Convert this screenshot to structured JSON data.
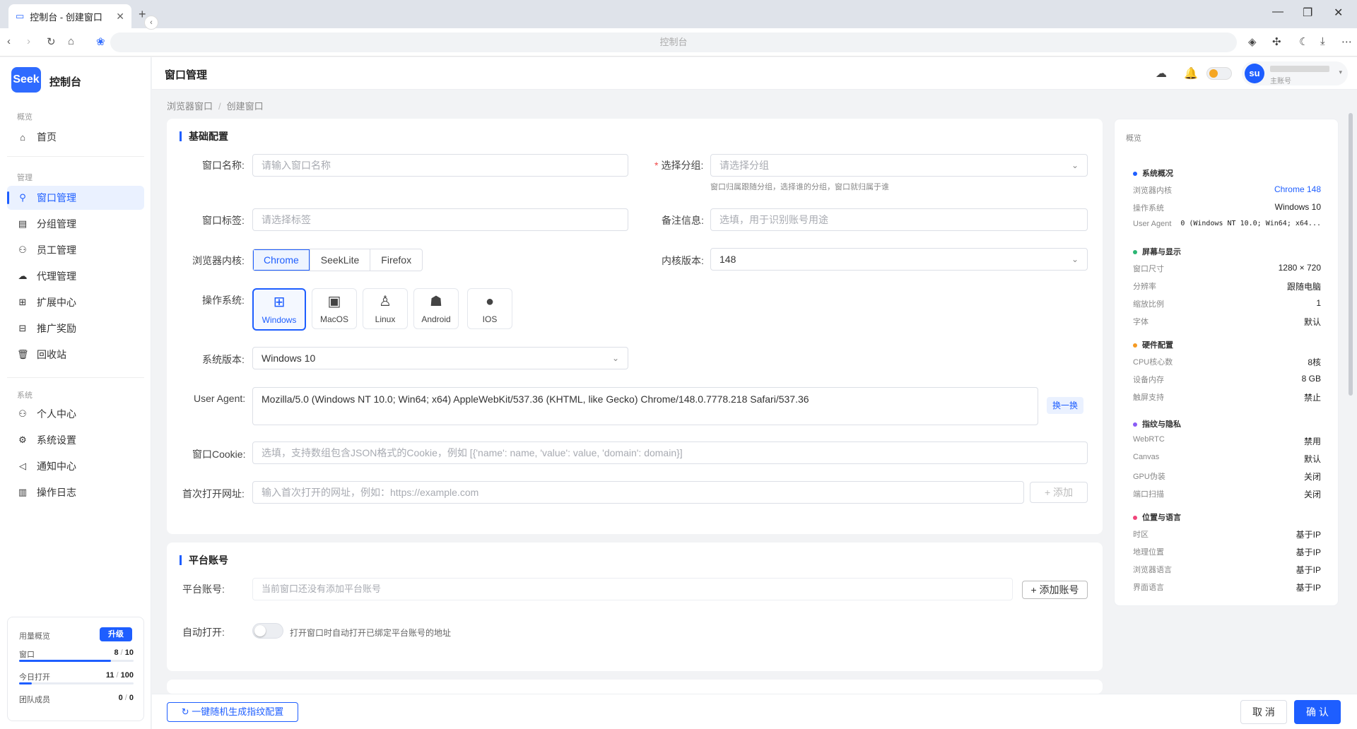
{
  "browser": {
    "tab_title": "控制台 - 创建窗口",
    "tab_close": "✕",
    "new_tab": "+",
    "url": "控制台"
  },
  "app": {
    "logo": "Seek",
    "title": "控制台",
    "page_title": "窗口管理"
  },
  "sidebar": {
    "sections": {
      "overview": "概览",
      "manage": "管理",
      "system": "系统"
    },
    "items": [
      {
        "label": "首页",
        "icon": "home-icon"
      },
      {
        "label": "窗口管理",
        "icon": "window-icon",
        "active": true
      },
      {
        "label": "分组管理",
        "icon": "group-icon"
      },
      {
        "label": "员工管理",
        "icon": "staff-icon"
      },
      {
        "label": "代理管理",
        "icon": "proxy-icon"
      },
      {
        "label": "扩展中心",
        "icon": "extension-icon"
      },
      {
        "label": "推广奖励",
        "icon": "gift-icon"
      },
      {
        "label": "回收站",
        "icon": "trash-icon"
      },
      {
        "label": "个人中心",
        "icon": "user-icon"
      },
      {
        "label": "系统设置",
        "icon": "gear-icon"
      },
      {
        "label": "通知中心",
        "icon": "megaphone-icon"
      },
      {
        "label": "操作日志",
        "icon": "chart-icon"
      }
    ],
    "usage": {
      "title": "用量概览",
      "upgrade": "升级",
      "rows": [
        {
          "label": "窗口",
          "used": "8",
          "total": "10",
          "fraction": 0.8
        },
        {
          "label": "今日打开",
          "used": "11",
          "total": "100",
          "fraction": 0.11
        },
        {
          "label": "团队成员",
          "used": "0",
          "total": "0",
          "fraction": 0
        }
      ]
    }
  },
  "header": {
    "user_avatar": "su",
    "user_role": "主账号"
  },
  "breadcrumb": {
    "parent": "浏览器窗口",
    "separator": "/",
    "current": "创建窗口"
  },
  "basic": {
    "title": "基础配置",
    "window_name_label": "窗口名称:",
    "window_name_placeholder": "请输入窗口名称",
    "group_label": "选择分组:",
    "group_required": "*",
    "group_placeholder": "请选择分组",
    "group_hint": "窗口归属跟随分组，选择谁的分组，窗口就归属于谁",
    "tag_label": "窗口标签:",
    "tag_placeholder": "请选择标签",
    "note_label": "备注信息:",
    "note_placeholder": "选填，用于识别账号用途",
    "kernel_label": "浏览器内核:",
    "kernels": [
      "Chrome",
      "SeekLite",
      "Firefox"
    ],
    "kernel_selected": "Chrome",
    "kernel_version_label": "内核版本:",
    "kernel_version": "148",
    "os_label": "操作系统:",
    "os_options": [
      "Windows",
      "MacOS",
      "Linux",
      "Android",
      "IOS"
    ],
    "os_selected": "Windows",
    "os_version_label": "系统版本:",
    "os_version": "Windows 10",
    "ua_label": "User Agent:",
    "ua_value": "Mozilla/5.0 (Windows NT 10.0; Win64; x64) AppleWebKit/537.36 (KHTML, like Gecko) Chrome/148.0.7778.218 Safari/537.36",
    "ua_change": "换一换",
    "cookie_label": "窗口Cookie:",
    "cookie_placeholder": "选填，支持数组包含JSON格式的Cookie，例如 [{'name': name, 'value': value, 'domain': domain}]",
    "url_label": "首次打开网址:",
    "url_placeholder": "输入首次打开的网址，例如：https://example.com",
    "url_add": "+ 添加"
  },
  "platform": {
    "title": "平台账号",
    "account_label": "平台账号:",
    "account_empty": "当前窗口还没有添加平台账号",
    "add_account": "+ 添加账号",
    "auto_open_label": "自动打开:",
    "auto_open_desc": "打开窗口时自动打开已绑定平台账号的地址",
    "auto_open": false
  },
  "overview": {
    "title": "概览",
    "sections": [
      {
        "title": "系统概况",
        "color": "#1e5eff",
        "rows": [
          {
            "k": "浏览器内核",
            "v": "Chrome 148",
            "style": "link"
          },
          {
            "k": "操作系统",
            "v": "Windows 10"
          },
          {
            "k": "User Agent",
            "v": "0 (Windows NT 10.0; Win64; x64...",
            "style": "mono"
          }
        ]
      },
      {
        "title": "屏幕与显示",
        "color": "#2bb673",
        "rows": [
          {
            "k": "窗口尺寸",
            "v": "1280 × 720"
          },
          {
            "k": "分辨率",
            "v": "跟随电脑"
          },
          {
            "k": "缩放比例",
            "v": "1"
          },
          {
            "k": "字体",
            "v": "默认"
          }
        ]
      },
      {
        "title": "硬件配置",
        "color": "#f59a23",
        "rows": [
          {
            "k": "CPU核心数",
            "v": "8核"
          },
          {
            "k": "设备内存",
            "v": "8 GB"
          },
          {
            "k": "触屏支持",
            "v": "禁止"
          }
        ]
      },
      {
        "title": "指纹与隐私",
        "color": "#8a5cf6",
        "rows": [
          {
            "k": "WebRTC",
            "v": "禁用"
          },
          {
            "k": "Canvas",
            "v": "默认"
          },
          {
            "k": "GPU伪装",
            "v": "关闭"
          },
          {
            "k": "端口扫描",
            "v": "关闭"
          }
        ]
      },
      {
        "title": "位置与语言",
        "color": "#f0447a",
        "rows": [
          {
            "k": "时区",
            "v": "基于IP"
          },
          {
            "k": "地理位置",
            "v": "基于IP"
          },
          {
            "k": "浏览器语言",
            "v": "基于IP"
          },
          {
            "k": "界面语言",
            "v": "基于IP"
          }
        ]
      }
    ]
  },
  "footer": {
    "generate": "一键随机生成指纹配置",
    "cancel": "取 消",
    "confirm": "确 认"
  }
}
